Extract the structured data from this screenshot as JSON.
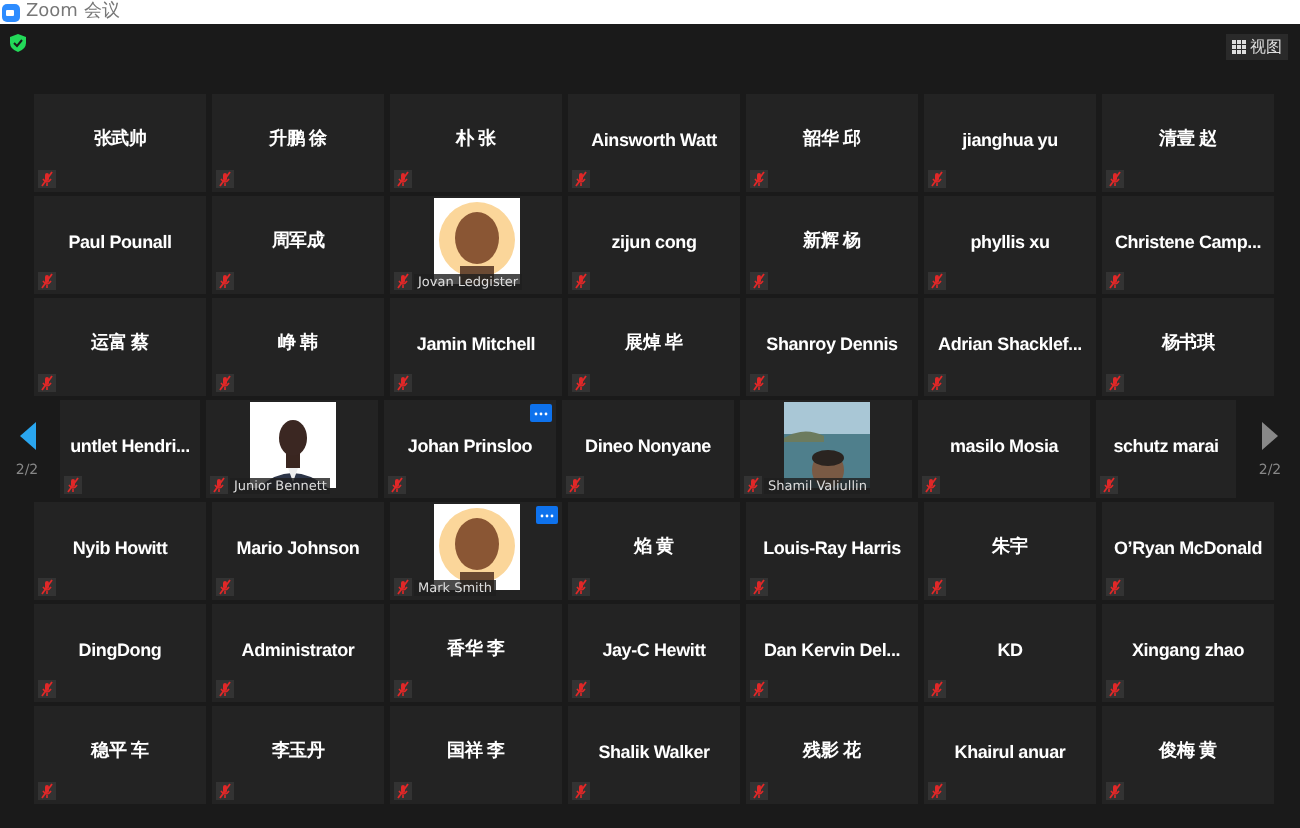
{
  "window": {
    "title": "Zoom 会议"
  },
  "view_button": {
    "label": "视图"
  },
  "rows": [
    {
      "tiles": [
        {
          "kind": "name",
          "name": "张武帅",
          "muted": true
        },
        {
          "kind": "name",
          "name": "升鹏 徐",
          "muted": true
        },
        {
          "kind": "name",
          "name": "朴 张",
          "muted": true
        },
        {
          "kind": "name",
          "name": "Ainsworth Watt",
          "muted": true
        },
        {
          "kind": "name",
          "name": "韶华 邱",
          "muted": true
        },
        {
          "kind": "name",
          "name": "jianghua yu",
          "muted": true
        },
        {
          "kind": "name",
          "name": "清壹 赵",
          "muted": true
        }
      ]
    },
    {
      "tiles": [
        {
          "kind": "name",
          "name": "Paul Pounall",
          "muted": true
        },
        {
          "kind": "name",
          "name": "周军成",
          "muted": true
        },
        {
          "kind": "video",
          "name": "Jovan Ledgister",
          "muted": true,
          "more": false
        },
        {
          "kind": "name",
          "name": "zijun cong",
          "muted": true
        },
        {
          "kind": "name",
          "name": "新辉 杨",
          "muted": true
        },
        {
          "kind": "name",
          "name": "phyllis xu",
          "muted": true
        },
        {
          "kind": "name",
          "name": "Christene  Camp...",
          "muted": true
        }
      ]
    },
    {
      "tiles": [
        {
          "kind": "name",
          "name": "运富 蔡",
          "muted": true
        },
        {
          "kind": "name",
          "name": "峥 韩",
          "muted": true
        },
        {
          "kind": "name",
          "name": "Jamin Mitchell",
          "muted": true
        },
        {
          "kind": "name",
          "name": "展焯 毕",
          "muted": true
        },
        {
          "kind": "name",
          "name": "Shanroy Dennis",
          "muted": true
        },
        {
          "kind": "name",
          "name": "Adrian  Shacklef...",
          "muted": true
        },
        {
          "kind": "name",
          "name": "杨书琪",
          "muted": true
        }
      ]
    },
    {
      "pager": {
        "left": "2/2",
        "right": "2/2"
      },
      "tiles": [
        {
          "kind": "name",
          "name": "untlet  Hendri...",
          "muted": true,
          "cut": true
        },
        {
          "kind": "video",
          "name": "Junior Bennett",
          "muted": true,
          "more": false
        },
        {
          "kind": "name",
          "name": "Johan Prinsloo",
          "muted": true,
          "more": true
        },
        {
          "kind": "name",
          "name": "Dineo Nonyane",
          "muted": true
        },
        {
          "kind": "video",
          "name": "Shamil Valiullin",
          "muted": true,
          "more": false
        },
        {
          "kind": "name",
          "name": "masilo Mosia",
          "muted": true
        },
        {
          "kind": "name",
          "name": "schutz marai",
          "muted": true,
          "cut": true
        }
      ]
    },
    {
      "tiles": [
        {
          "kind": "name",
          "name": "Nyib Howitt",
          "muted": true
        },
        {
          "kind": "name",
          "name": "Mario Johnson",
          "muted": true
        },
        {
          "kind": "video",
          "name": "Mark Smith",
          "muted": true,
          "more": true
        },
        {
          "kind": "name",
          "name": "焰 黄",
          "muted": true
        },
        {
          "kind": "name",
          "name": "Louis-Ray Harris",
          "muted": true
        },
        {
          "kind": "name",
          "name": "朱宇",
          "muted": true
        },
        {
          "kind": "name",
          "name": "O’Ryan McDonald",
          "muted": true
        }
      ]
    },
    {
      "tiles": [
        {
          "kind": "name",
          "name": "DingDong",
          "muted": true
        },
        {
          "kind": "name",
          "name": "Administrator",
          "muted": true
        },
        {
          "kind": "name",
          "name": "香华 李",
          "muted": true
        },
        {
          "kind": "name",
          "name": "Jay-C Hewitt",
          "muted": true
        },
        {
          "kind": "name",
          "name": "Dan Kervin Del...",
          "muted": true
        },
        {
          "kind": "name",
          "name": "KD",
          "muted": true
        },
        {
          "kind": "name",
          "name": "Xingang zhao",
          "muted": true
        }
      ]
    },
    {
      "tiles": [
        {
          "kind": "name",
          "name": "稳平 车",
          "muted": true
        },
        {
          "kind": "name",
          "name": "李玉丹",
          "muted": true
        },
        {
          "kind": "name",
          "name": "国祥 李",
          "muted": true
        },
        {
          "kind": "name",
          "name": "Shalik Walker",
          "muted": true
        },
        {
          "kind": "name",
          "name": "残影 花",
          "muted": true
        },
        {
          "kind": "name",
          "name": "Khairul anuar",
          "muted": true
        },
        {
          "kind": "name",
          "name": "俊梅 黄",
          "muted": true
        }
      ]
    }
  ]
}
